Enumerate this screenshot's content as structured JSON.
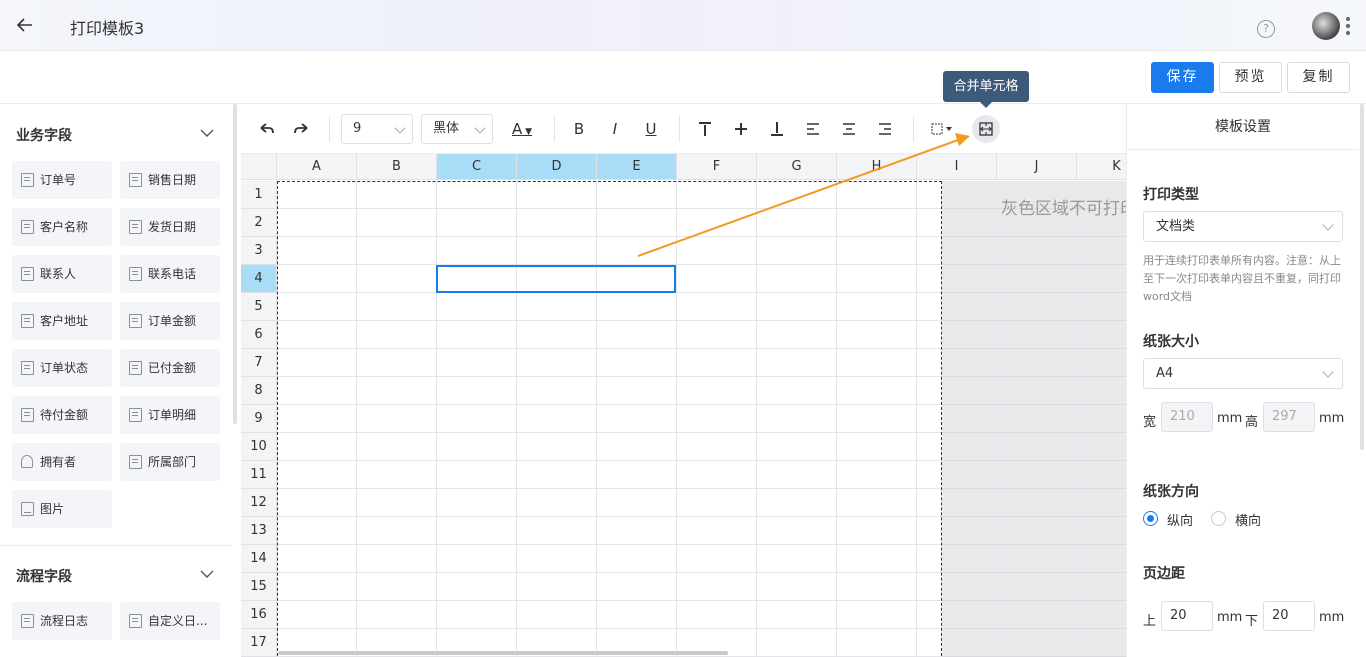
{
  "header": {
    "title": "打印模板3",
    "help_glyph": "?"
  },
  "actions": {
    "save": "保存",
    "preview": "预览",
    "copy": "复制"
  },
  "tooltip": "合并单元格",
  "business_section": {
    "title": "业务字段",
    "fields": [
      "订单号",
      "销售日期",
      "客户名称",
      "发货日期",
      "联系人",
      "联系电话",
      "客户地址",
      "订单金额",
      "订单状态",
      "已付金额",
      "待付金额",
      "订单明细",
      "拥有者",
      "所属部门",
      "图片"
    ]
  },
  "flow_section": {
    "title": "流程字段",
    "fields": [
      "流程日志",
      "自定义日..."
    ]
  },
  "toolbar": {
    "font_size": "9",
    "font_family": "黑体",
    "font_color_glyph": "A",
    "bold": "B",
    "italic": "I",
    "underline": "U"
  },
  "grid": {
    "columns": [
      "A",
      "B",
      "C",
      "D",
      "E",
      "F",
      "G",
      "H",
      "I",
      "J",
      "K"
    ],
    "selected_columns": [
      "C",
      "D",
      "E"
    ],
    "rows": [
      "1",
      "2",
      "3",
      "4",
      "5",
      "6",
      "7",
      "8",
      "9",
      "10",
      "11",
      "12",
      "13",
      "14",
      "15",
      "16",
      "17"
    ],
    "selected_row": "4",
    "gray_note": "灰色区域不可打印"
  },
  "settings": {
    "title": "模板设置",
    "print_type_label": "打印类型",
    "print_type_value": "文档类",
    "print_type_hint": "用于连续打印表单所有内容。注意：从上至下一次打印表单内容且不重复，同打印word文档",
    "paper_size_label": "纸张大小",
    "paper_size_value": "A4",
    "width_label": "宽",
    "width_value": "210",
    "height_label": "高",
    "height_value": "297",
    "unit": "mm",
    "orientation_label": "纸张方向",
    "orientation_portrait": "纵向",
    "orientation_landscape": "横向",
    "margin_label": "页边距",
    "margin_top_label": "上",
    "margin_top_value": "20",
    "margin_bottom_label": "下",
    "margin_bottom_value": "20"
  },
  "colors": {
    "accent": "#1a7bec",
    "selected_header": "#a9dcf7",
    "annotation_arrow": "#f39a1e",
    "tooltip_bg": "#3d5a7a"
  }
}
